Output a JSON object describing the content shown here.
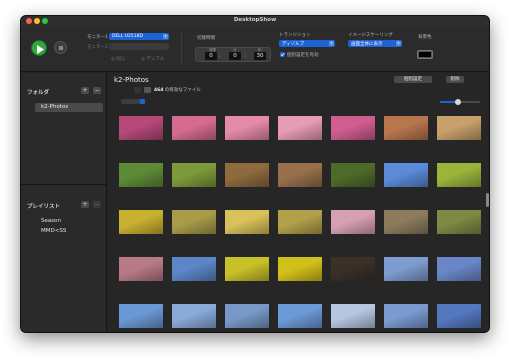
{
  "window": {
    "title": "DesktopShow"
  },
  "toolbar": {
    "monitor1_label": "モニター1",
    "monitor1_value": "DELL U2518D",
    "monitor2_label": "モニター2",
    "option_same": "同じ",
    "option_dual": "デュアル",
    "interval_label": "切替時間",
    "interval_units": [
      "時間",
      "分",
      "秒"
    ],
    "interval_values": [
      "0",
      "0",
      "30"
    ],
    "transition_label": "トランジション",
    "transition_value": "ディゾルブ",
    "individual_setting_label": "個別設定を有効",
    "scaling_label": "イメージスケーリング",
    "scaling_value": "画面全体に表示",
    "bgcolor_label": "背景色",
    "colors": {
      "accent": "#1d63d6",
      "play": "#2fa83c",
      "background_well": "#000000"
    }
  },
  "sidebar": {
    "folders_title": "フォルダ",
    "add_label": "+",
    "remove_label": "−",
    "folders": [
      "k2-Photos"
    ],
    "playlists_title": "プレイリスト",
    "playlists": [
      "Season",
      "MMD<SS"
    ]
  },
  "main": {
    "folder_title": "k2-Photos",
    "file_count": "464",
    "file_count_suffix": "の有効なファイル",
    "individual_button": "個別設定",
    "delete_button": "削除",
    "thumbnail_size_fraction": 0.45,
    "grid": {
      "columns": 7,
      "rows": [
        [
          "#b6487a",
          "#d66b92",
          "#e58aa9",
          "#e79bb6",
          "#d05d8f",
          "#b8764e",
          "#c9a06c"
        ],
        [
          "#5d8a36",
          "#7c9a3a",
          "#8e6a3e",
          "#96704c",
          "#4e6a2a",
          "#5a8ad8",
          "#9ab53a"
        ],
        [
          "#c8b030",
          "#a89c48",
          "#d9c25a",
          "#b2a04a",
          "#d7a0b0",
          "#8c7c5c",
          "#7c8a44"
        ],
        [
          "#b87a86",
          "#5c86c8",
          "#c8c028",
          "#d2c01a",
          "#3a3028",
          "#7e9cd0",
          "#6a86c8"
        ],
        [
          "#6a98d4",
          "#8aaad8",
          "#7898c8",
          "#6c9ad8",
          "#b4c6e0",
          "#7a9ad0",
          "#5478c0"
        ]
      ]
    }
  }
}
